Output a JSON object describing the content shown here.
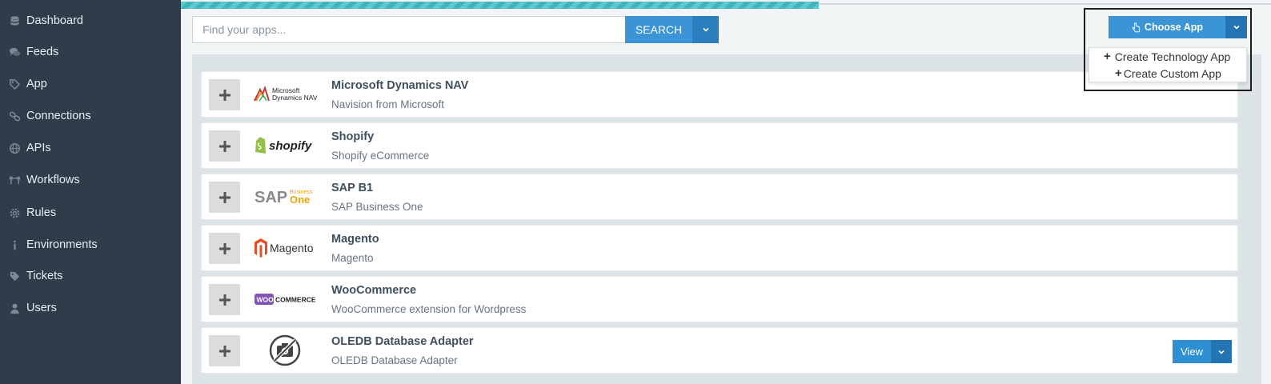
{
  "sidebar": {
    "items": [
      {
        "label": "Dashboard",
        "icon": "database-icon"
      },
      {
        "label": "Feeds",
        "icon": "comments-icon"
      },
      {
        "label": "App",
        "icon": "tag-icon"
      },
      {
        "label": "Connections",
        "icon": "link-icon"
      },
      {
        "label": "APIs",
        "icon": "globe-icon"
      },
      {
        "label": "Workflows",
        "icon": "workflow-icon"
      },
      {
        "label": "Rules",
        "icon": "gear-icon"
      },
      {
        "label": "Environments",
        "icon": "info-icon"
      },
      {
        "label": "Tickets",
        "icon": "ticket-icon"
      },
      {
        "label": "Users",
        "icon": "user-icon"
      }
    ]
  },
  "progress": {
    "fraction": 0.585
  },
  "search": {
    "placeholder": "Find your apps...",
    "value": "",
    "button_label": "SEARCH"
  },
  "choose_app": {
    "label": "Choose App",
    "menu": [
      "Create Technology App",
      "Create Custom App"
    ]
  },
  "apps": [
    {
      "name": "Microsoft Dynamics NAV",
      "description": "Navision from Microsoft",
      "logo": "microsoft-dynamics-nav-logo",
      "logo_text": [
        "Microsoft",
        "Dynamics NAV"
      ]
    },
    {
      "name": "Shopify",
      "description": "Shopify eCommerce",
      "logo": "shopify-logo",
      "logo_text": [
        "shopify"
      ]
    },
    {
      "name": "SAP B1",
      "description": "SAP Business One",
      "logo": "sap-business-one-logo",
      "logo_text": [
        "SAP",
        "Business",
        "One"
      ]
    },
    {
      "name": "Magento",
      "description": "Magento",
      "logo": "magento-logo",
      "logo_text": [
        "Magento"
      ]
    },
    {
      "name": "WooCommerce",
      "description": "WooCommerce extension for Wordpress",
      "logo": "woocommerce-logo",
      "logo_text": [
        "WOO",
        "COMMERCE"
      ]
    },
    {
      "name": "OLEDB Database Adapter",
      "description": "OLEDB Database Adapter",
      "logo": "no-image-icon",
      "view_label": "View"
    }
  ],
  "colors": {
    "sidebar": "#2f3d4b",
    "accent": "#3a94d6",
    "accent_dark": "#2473b3",
    "progress": "#5ec8cf"
  }
}
